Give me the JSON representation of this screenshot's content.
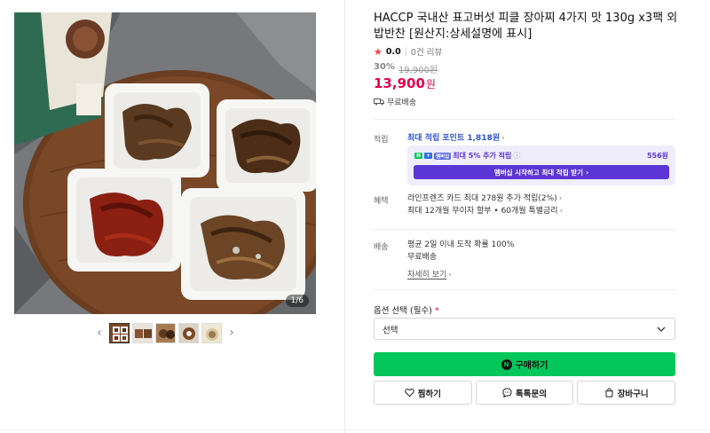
{
  "product": {
    "title": "HACCP 국내산 표고버섯 피클 장아찌 4가지 맛 130g x3팩 외 밥반찬 [원산지:상세설명에 표시]",
    "rating": "0.0",
    "reviews": "0건 리뷰",
    "discount": "30%",
    "original_price": "19,900원",
    "sale_price": "13,900",
    "sale_unit": "원",
    "shipping_badge": "무료배송"
  },
  "gallery": {
    "counter": "1/6",
    "prev_icon": "chevron-left-icon",
    "next_icon": "chevron-right-icon",
    "thumbnail_count": 5
  },
  "points": {
    "label": "적립",
    "link": "최대 적립 포인트 1,818원",
    "promo_n": "N",
    "promo_plus": "+",
    "promo_membership": "멤버십",
    "promo_text": "최대 5% 추가 적립",
    "promo_amount": "556원",
    "promo_button": "멤버십 시작하고 최대 적립 받기"
  },
  "benefits": {
    "label": "혜택",
    "line1": "라인프렌즈 카드 최대 278원 추가 적립(2%)",
    "line2": "최대 12개월 무이자 할부 • 60개월 특별금리"
  },
  "delivery": {
    "label": "배송",
    "line1": "평균 2일 이내 도착 확률 100%",
    "line2": "무료배송",
    "detail_link": "자세히 보기"
  },
  "options": {
    "label": "옵션 선택 (필수)",
    "required_mark": "*",
    "placeholder": "선택"
  },
  "actions": {
    "buy_icon_letter": "N",
    "buy": "구매하기",
    "wish": "찜하기",
    "talk": "톡톡문의",
    "cart": "장바구니"
  },
  "colors": {
    "naver_green": "#03c75a",
    "price_red": "#e6004c",
    "membership_purple": "#5b35d5",
    "link_blue": "#2f55d4"
  }
}
